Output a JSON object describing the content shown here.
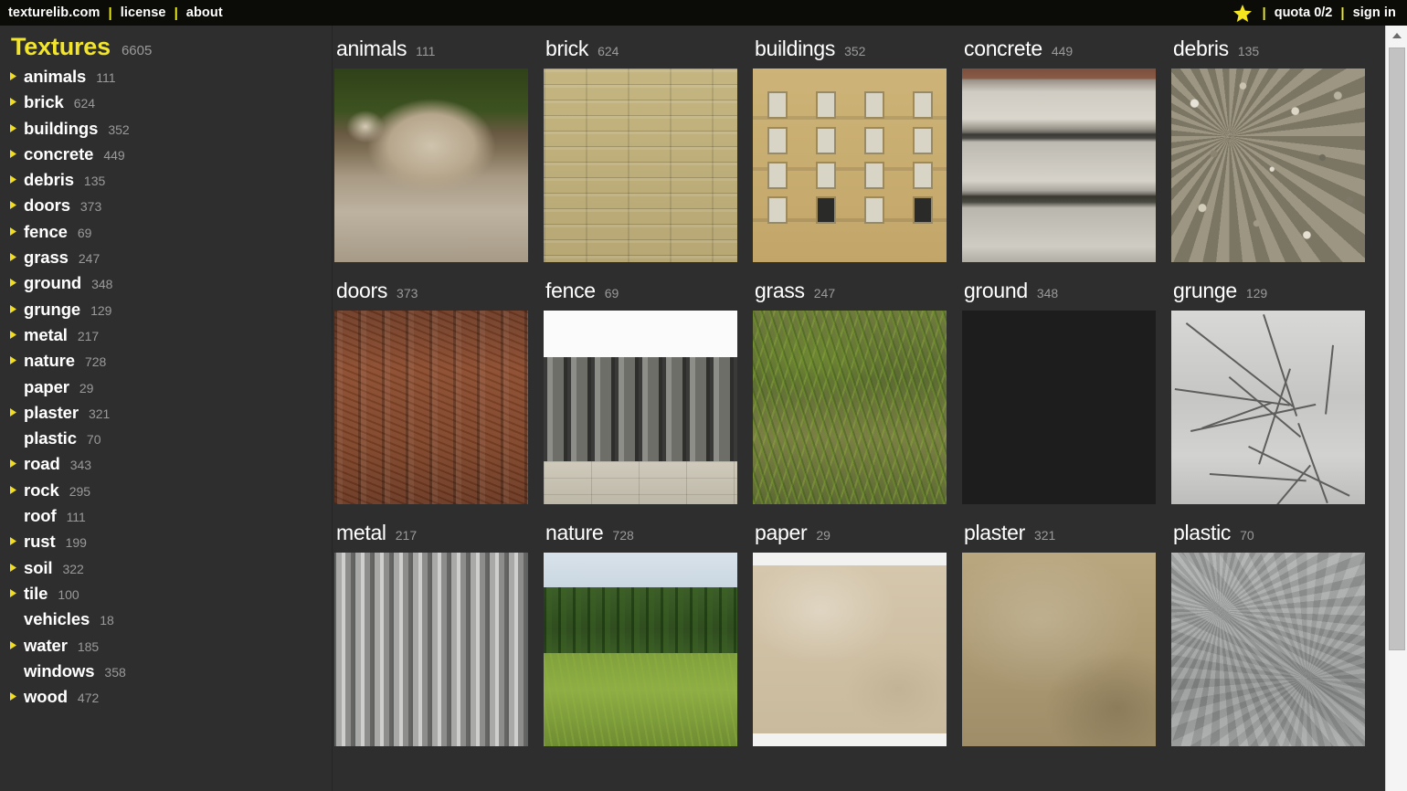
{
  "topbar": {
    "links": [
      {
        "label": "texturelib.com",
        "name": "home-link"
      },
      {
        "label": "license",
        "name": "license-link"
      },
      {
        "label": "about",
        "name": "about-link"
      }
    ],
    "separator": "|",
    "star_icon": "star-icon",
    "quota": "quota 0/2",
    "sign_in": "sign in"
  },
  "sidebar": {
    "title": "Textures",
    "total": "6605",
    "items": [
      {
        "label": "animals",
        "count": "111",
        "expandable": true
      },
      {
        "label": "brick",
        "count": "624",
        "expandable": true
      },
      {
        "label": "buildings",
        "count": "352",
        "expandable": true
      },
      {
        "label": "concrete",
        "count": "449",
        "expandable": true
      },
      {
        "label": "debris",
        "count": "135",
        "expandable": true
      },
      {
        "label": "doors",
        "count": "373",
        "expandable": true
      },
      {
        "label": "fence",
        "count": "69",
        "expandable": true
      },
      {
        "label": "grass",
        "count": "247",
        "expandable": true
      },
      {
        "label": "ground",
        "count": "348",
        "expandable": true
      },
      {
        "label": "grunge",
        "count": "129",
        "expandable": true
      },
      {
        "label": "metal",
        "count": "217",
        "expandable": true
      },
      {
        "label": "nature",
        "count": "728",
        "expandable": true
      },
      {
        "label": "paper",
        "count": "29",
        "expandable": false
      },
      {
        "label": "plaster",
        "count": "321",
        "expandable": true
      },
      {
        "label": "plastic",
        "count": "70",
        "expandable": false
      },
      {
        "label": "road",
        "count": "343",
        "expandable": true
      },
      {
        "label": "rock",
        "count": "295",
        "expandable": true
      },
      {
        "label": "roof",
        "count": "111",
        "expandable": false
      },
      {
        "label": "rust",
        "count": "199",
        "expandable": true
      },
      {
        "label": "soil",
        "count": "322",
        "expandable": true
      },
      {
        "label": "tile",
        "count": "100",
        "expandable": true
      },
      {
        "label": "vehicles",
        "count": "18",
        "expandable": false
      },
      {
        "label": "water",
        "count": "185",
        "expandable": true
      },
      {
        "label": "windows",
        "count": "358",
        "expandable": false
      },
      {
        "label": "wood",
        "count": "472",
        "expandable": true
      }
    ]
  },
  "grid": {
    "tiles": [
      {
        "label": "animals",
        "count": "111",
        "tex": "animals"
      },
      {
        "label": "brick",
        "count": "624",
        "tex": "brick"
      },
      {
        "label": "buildings",
        "count": "352",
        "tex": "buildings"
      },
      {
        "label": "concrete",
        "count": "449",
        "tex": "concrete"
      },
      {
        "label": "debris",
        "count": "135",
        "tex": "debris"
      },
      {
        "label": "doors",
        "count": "373",
        "tex": "doors"
      },
      {
        "label": "fence",
        "count": "69",
        "tex": "fence"
      },
      {
        "label": "grass",
        "count": "247",
        "tex": "grass"
      },
      {
        "label": "ground",
        "count": "348",
        "tex": "ground"
      },
      {
        "label": "grunge",
        "count": "129",
        "tex": "grunge"
      },
      {
        "label": "metal",
        "count": "217",
        "tex": "metal"
      },
      {
        "label": "nature",
        "count": "728",
        "tex": "nature"
      },
      {
        "label": "paper",
        "count": "29",
        "tex": "paper"
      },
      {
        "label": "plaster",
        "count": "321",
        "tex": "plaster"
      },
      {
        "label": "plastic",
        "count": "70",
        "tex": "plastic"
      }
    ]
  },
  "scrollbar": {
    "up_arrow_icon": "scroll-up-arrow-icon"
  },
  "colors": {
    "page_background": "#2e2e2e",
    "topbar_background": "#0b0b07",
    "accent_yellow": "#f2e52b",
    "text_white": "#ffffff",
    "text_muted": "#9a9a9a"
  }
}
